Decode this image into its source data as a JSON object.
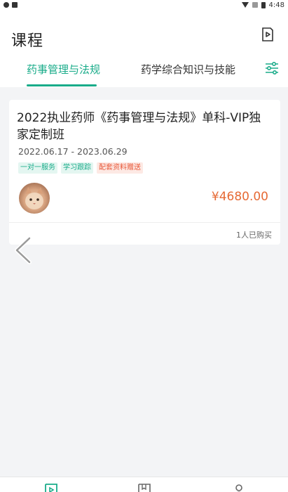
{
  "status_bar": {
    "time": "4:48"
  },
  "header": {
    "title": "课程"
  },
  "tabs": [
    {
      "label": "药事管理与法规",
      "active": true
    },
    {
      "label": "药学综合知识与技能",
      "active": false
    }
  ],
  "course": {
    "title": "2022执业药师《药事管理与法规》单科-VIP独家定制班",
    "date_range": "2022.06.17 - 2023.06.29",
    "tags": [
      {
        "label": "一对一服务",
        "color": "green"
      },
      {
        "label": "学习跟踪",
        "color": "green"
      },
      {
        "label": "配套资料赠送",
        "color": "red"
      }
    ],
    "price": "¥4680.00",
    "buyers": "1人已购买"
  },
  "colors": {
    "accent": "#1aac8a",
    "price": "#e66a35",
    "background": "#f3f4f6"
  },
  "icons": {
    "header_right": "video-play-icon",
    "tabs_right": "filter-sliders-icon",
    "overlay_left": "back-chevron-icon",
    "bottom_nav": [
      "play-tab-icon",
      "book-tab-icon",
      "person-tab-icon"
    ]
  }
}
